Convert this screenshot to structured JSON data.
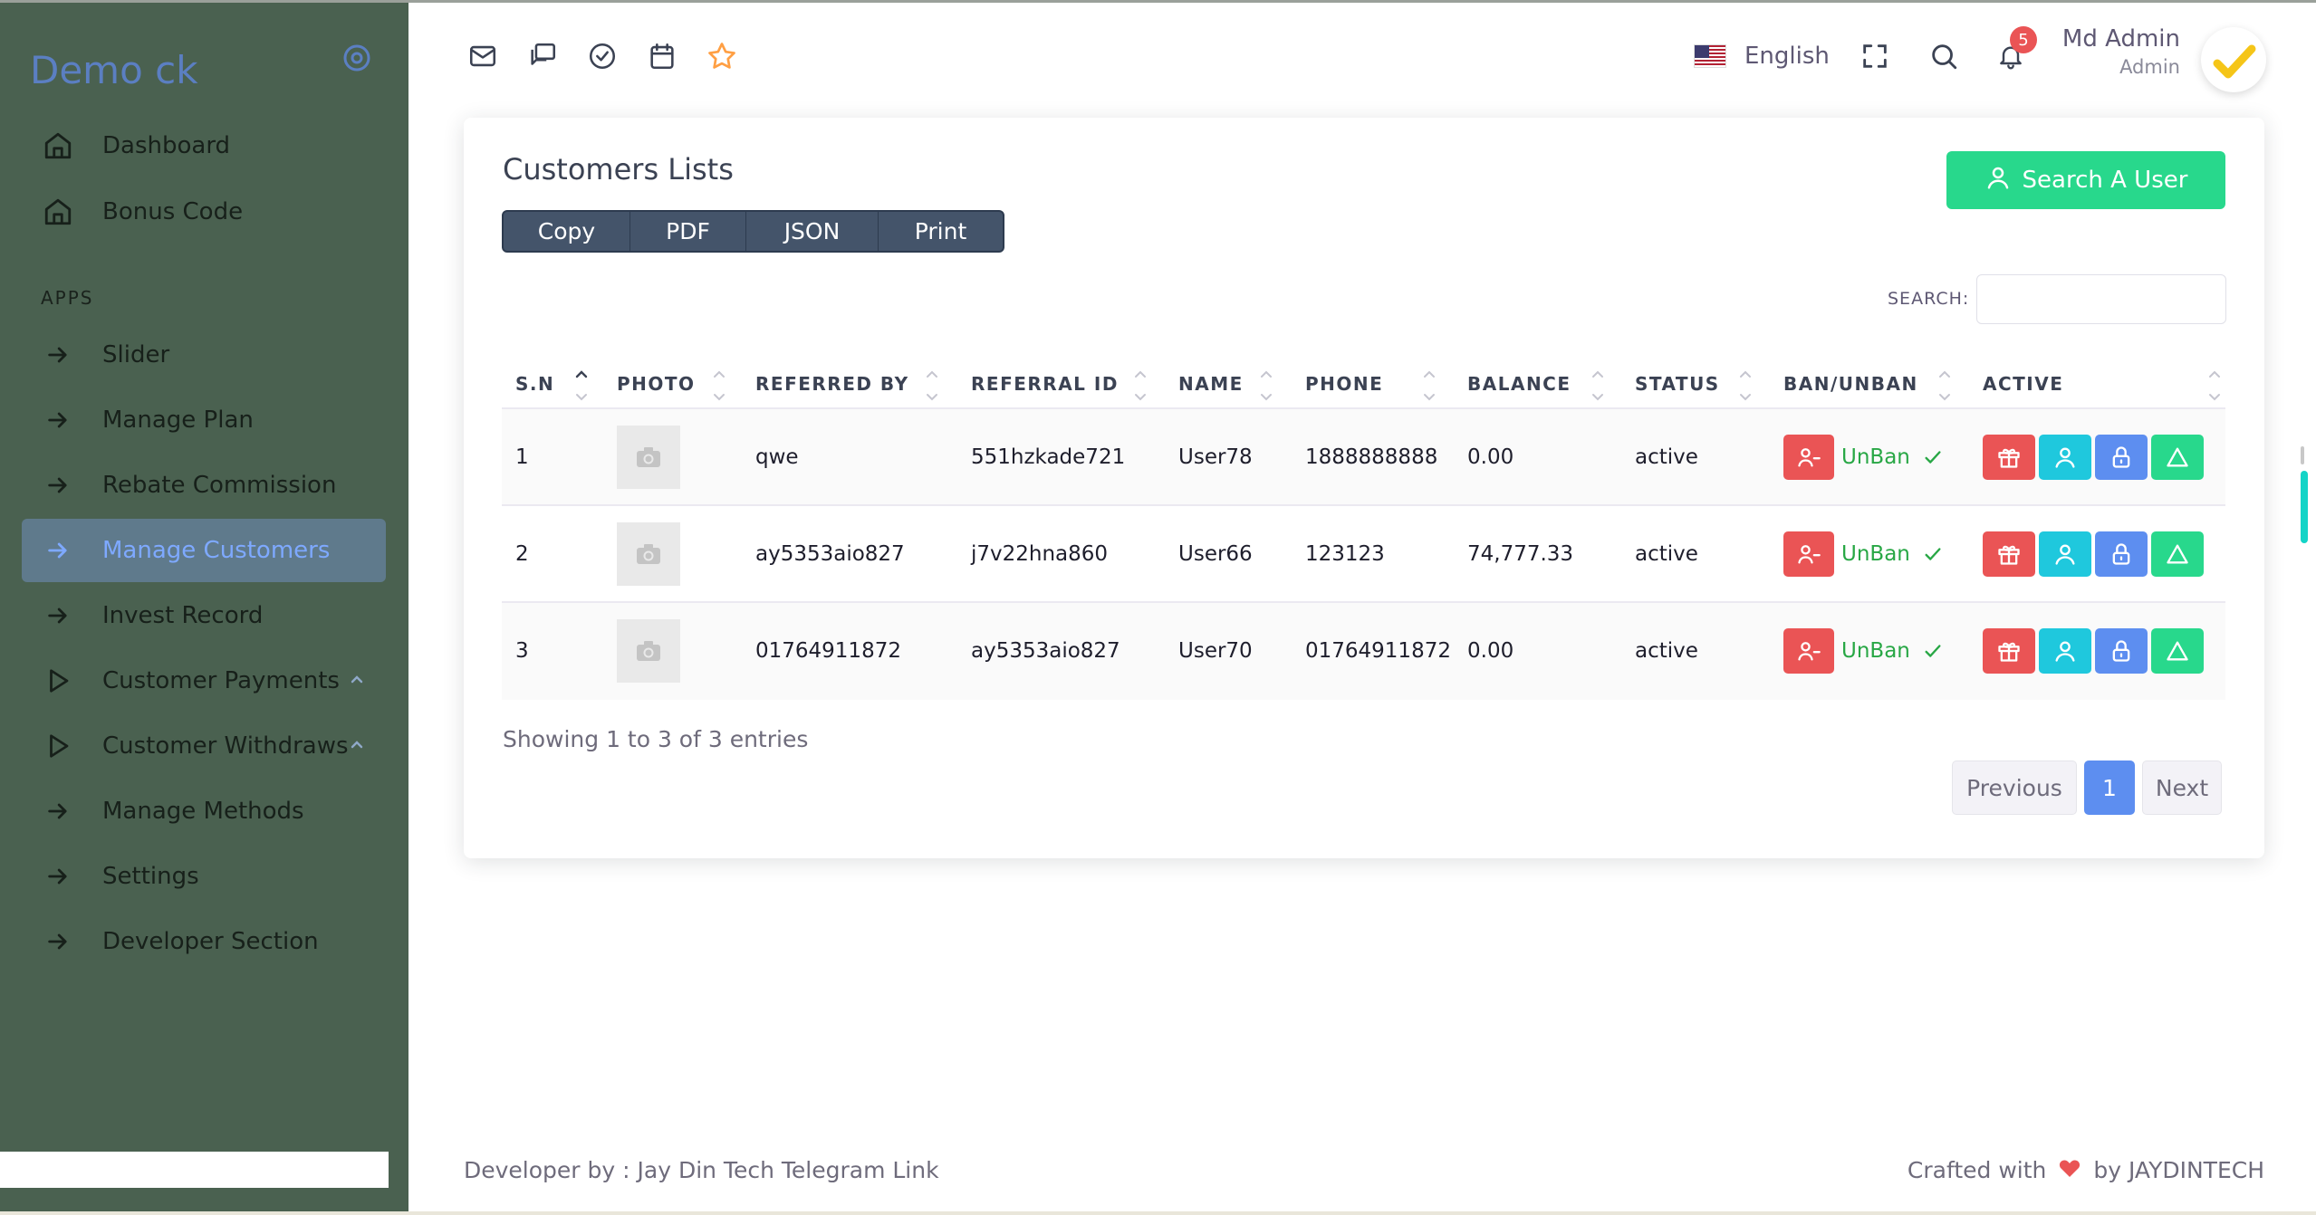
{
  "brand": {
    "name": "Demo ck"
  },
  "sidebar": {
    "section_apps": "APPS",
    "items": [
      {
        "label": "Dashboard",
        "icon": "home-icon"
      },
      {
        "label": "Bonus Code",
        "icon": "home-icon"
      },
      {
        "label": "Slider",
        "icon": "arrow-right-icon"
      },
      {
        "label": "Manage Plan",
        "icon": "arrow-right-icon"
      },
      {
        "label": "Rebate Commission",
        "icon": "arrow-right-icon"
      },
      {
        "label": "Manage Customers",
        "icon": "arrow-right-icon",
        "active": true
      },
      {
        "label": "Invest Record",
        "icon": "arrow-right-icon"
      },
      {
        "label": "Customer Payments",
        "icon": "play-icon",
        "expandable": true
      },
      {
        "label": "Customer Withdraws",
        "icon": "play-icon",
        "expandable": true
      },
      {
        "label": "Manage Methods",
        "icon": "arrow-right-icon"
      },
      {
        "label": "Settings",
        "icon": "arrow-right-icon"
      },
      {
        "label": "Developer Section",
        "icon": "arrow-right-icon"
      }
    ]
  },
  "header": {
    "icons": [
      "mail-icon",
      "chat-icon",
      "check-circle-icon",
      "calendar-icon",
      "star-icon"
    ],
    "language": "English",
    "notification_count": "5",
    "user_name": "Md Admin",
    "user_role": "Admin"
  },
  "card": {
    "title": "Customers Lists",
    "search_user_button": "Search A User",
    "export_buttons": [
      "Copy",
      "PDF",
      "JSON",
      "Print"
    ],
    "search_label": "SEARCH:",
    "search_value": ""
  },
  "table": {
    "columns": [
      "S.N",
      "PHOTO",
      "REFERRED BY",
      "REFERRAL ID",
      "NAME",
      "PHONE",
      "BALANCE",
      "STATUS",
      "BAN/UNBAN",
      "ACTIVE"
    ],
    "rows": [
      {
        "sn": "1",
        "referred_by": "qwe",
        "referral_id": "551hzkade721",
        "name": "User78",
        "phone": "1888888888",
        "balance": "0.00",
        "status": "active",
        "unban": "UnBan"
      },
      {
        "sn": "2",
        "referred_by": "ay5353aio827",
        "referral_id": "j7v22hna860",
        "name": "User66",
        "phone": "123123",
        "balance": "74,777.33",
        "status": "active",
        "unban": "UnBan"
      },
      {
        "sn": "3",
        "referred_by": "01764911872",
        "referral_id": "ay5353aio827",
        "name": "User70",
        "phone": "01764911872",
        "balance": "0.00",
        "status": "active",
        "unban": "UnBan"
      }
    ],
    "showing": "Showing 1 to 3 of 3 entries"
  },
  "pagination": {
    "previous": "Previous",
    "current": "1",
    "next": "Next"
  },
  "footer": {
    "left": "Developer by : Jay Din Tech Telegram Link",
    "crafted": "Crafted with",
    "by": "by JAYDINTECH"
  },
  "colors": {
    "sidebar_bg": "#4a6150",
    "accent": "#5d8ef0",
    "success": "#28d88c",
    "danger": "#ea5455",
    "info": "#1fc8dd"
  }
}
